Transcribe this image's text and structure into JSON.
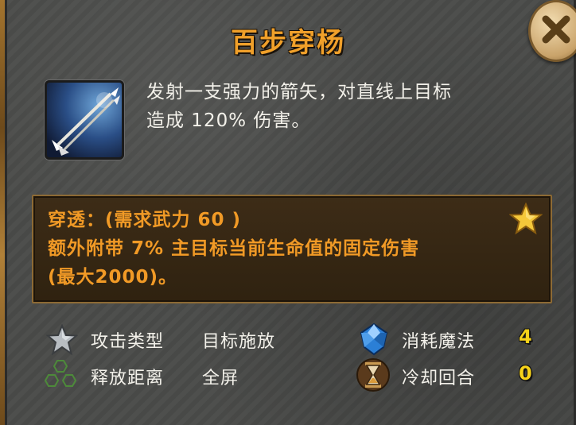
{
  "skill": {
    "name": "百步穿杨",
    "icon": "arrow-skill-icon",
    "description_line1": "发射一支强力的箭矢，对直线上目标",
    "description_line2": "造成 120% 伤害。"
  },
  "passive": {
    "line1": "穿透：(需求武力 60 )",
    "line2": "额外附带 7% 主目标当前生命值的固定伤害",
    "line3": "(最大2000)。",
    "icon": "star-icon"
  },
  "stats": {
    "attack_type_label": "攻击类型",
    "attack_type_value": "目标施放",
    "range_label": "释放距离",
    "range_value": "全屏",
    "mana_label": "消耗魔法",
    "mana_value": "4",
    "cooldown_label": "冷却回合",
    "cooldown_value": "0"
  },
  "colors": {
    "title": "#f0a02a",
    "passive_text": "#f19a26",
    "stat_number": "#f6d21a"
  }
}
